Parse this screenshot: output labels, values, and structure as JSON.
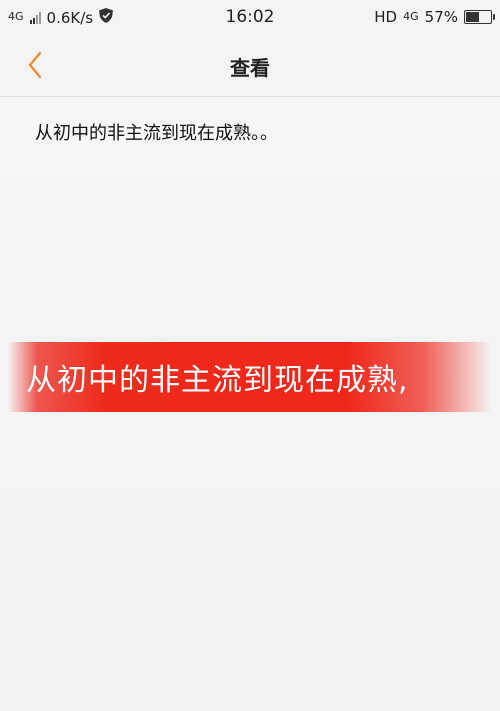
{
  "status_bar": {
    "network_small": "4G",
    "speed": "0.6K/s",
    "time": "16:02",
    "hd": "HD",
    "network": "4G",
    "battery_percent": "57%",
    "battery_level": 0.57,
    "icons": [
      "signal-icon",
      "shield-icon",
      "battery-icon"
    ]
  },
  "nav": {
    "title": "查看",
    "back_icon": "chevron-left-icon",
    "accent_color": "#f08a24"
  },
  "content": {
    "body_text": "从初中的非主流到现在成熟。。",
    "banner_text": "从初中的非主流到现在成熟,",
    "banner_color": "#ee2a1a"
  }
}
